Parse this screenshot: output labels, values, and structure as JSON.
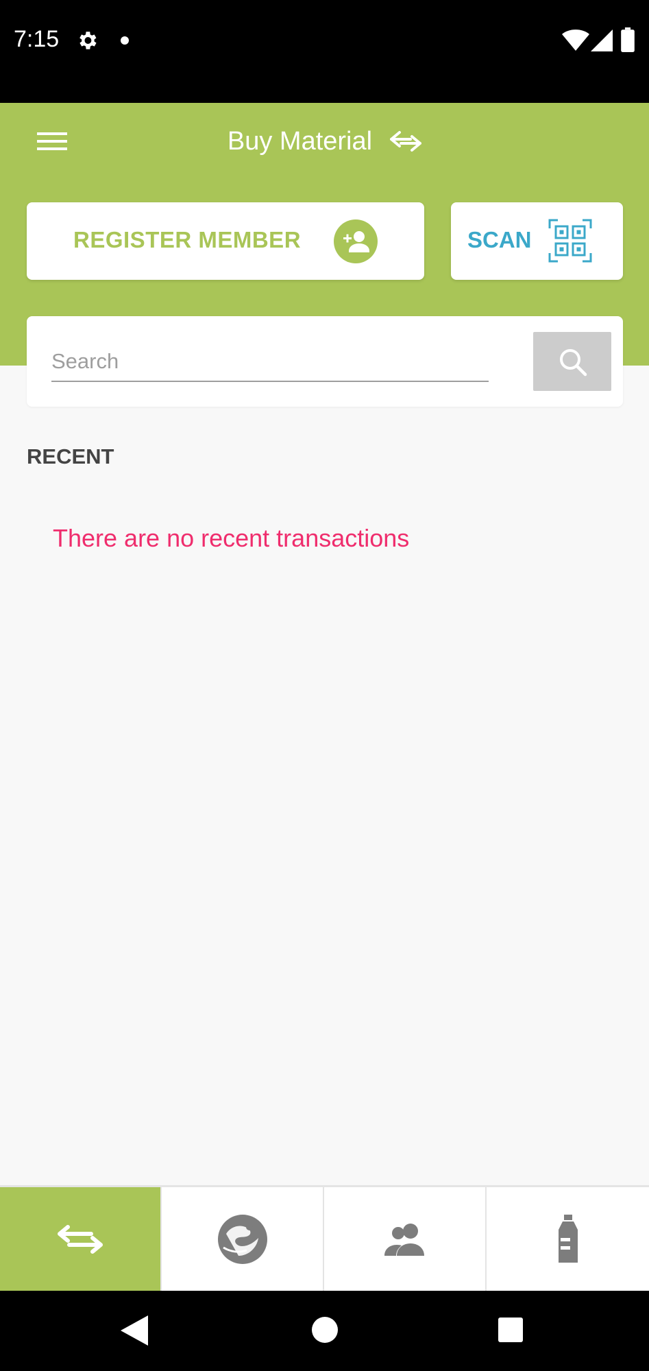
{
  "status_bar": {
    "time": "7:15",
    "icons": [
      "gear-icon",
      "notification-dot-icon",
      "wifi-icon",
      "cell-signal-icon",
      "battery-icon"
    ]
  },
  "header": {
    "title": "Buy Material",
    "menu_icon": "hamburger-menu-icon",
    "title_icon": "swap-arrows-icon",
    "background_color": "#a9c557"
  },
  "actions": {
    "register_label": "REGISTER MEMBER",
    "register_icon": "add-person-icon",
    "scan_label": "SCAN",
    "scan_icon": "qr-code-icon",
    "register_color": "#a9c557",
    "scan_color": "#3ba8c9"
  },
  "search": {
    "placeholder": "Search",
    "value": "",
    "button_icon": "search-icon"
  },
  "recent": {
    "heading": "RECENT",
    "empty_message": "There are no recent transactions",
    "empty_color": "#ef2d6d"
  },
  "bottom_nav": {
    "items": [
      {
        "icon": "transactions-icon",
        "active": true
      },
      {
        "icon": "globe-icon",
        "active": false
      },
      {
        "icon": "members-icon",
        "active": false
      },
      {
        "icon": "bottle-icon",
        "active": false
      }
    ]
  },
  "system_nav": {
    "icons": [
      "back-icon",
      "home-icon",
      "recents-icon"
    ]
  }
}
